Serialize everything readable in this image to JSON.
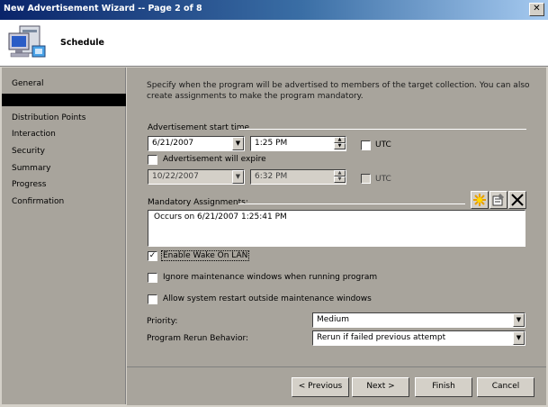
{
  "window": {
    "title": "New Advertisement Wizard -- Page 2 of 8",
    "close_glyph": "✕"
  },
  "header": {
    "title": "Schedule",
    "icon": "computer-icon"
  },
  "sidebar": {
    "items": [
      {
        "label": "General"
      },
      {
        "label": ""
      },
      {
        "label": "Distribution Points"
      },
      {
        "label": "Interaction"
      },
      {
        "label": "Security"
      },
      {
        "label": "Summary"
      },
      {
        "label": "Progress"
      },
      {
        "label": "Confirmation"
      }
    ],
    "selected_index": 1
  },
  "main": {
    "description": "Specify when the program will be advertised to members of the target collection. You can also create assignments to make the program mandatory.",
    "start_time": {
      "group_label": "Advertisement start time",
      "date": "6/21/2007",
      "time": "1:25 PM",
      "utc_label": "UTC",
      "utc_checked": false
    },
    "expire": {
      "label": "Advertisement will expire",
      "checked": false,
      "date": "10/22/2007",
      "time": "6:32 PM",
      "utc_label": "UTC",
      "utc_checked": false
    },
    "mandatory": {
      "group_label": "Mandatory Assignments:",
      "items": [
        "Occurs on 6/21/2007 1:25:41 PM"
      ],
      "toolbar": {
        "new_icon": "star-new-icon",
        "properties_icon": "properties-icon",
        "delete_icon": "delete-x-icon"
      }
    },
    "options": {
      "wake_on_lan": {
        "label": "Enable Wake On LAN",
        "checked": true
      },
      "ignore_maintenance": {
        "label": "Ignore maintenance windows when running program",
        "checked": false
      },
      "allow_restart": {
        "label": "Allow system restart outside maintenance windows",
        "checked": false
      }
    },
    "priority": {
      "label": "Priority:",
      "value": "Medium"
    },
    "rerun": {
      "label": "Program Rerun Behavior:",
      "value": "Rerun if failed previous attempt"
    }
  },
  "footer": {
    "previous": "< Previous",
    "next": "Next >",
    "finish": "Finish",
    "cancel": "Cancel"
  },
  "colors": {
    "title_gradient_start": "#0a246a",
    "title_gradient_end": "#a6caf0",
    "panel_bg": "#a8a49c"
  }
}
